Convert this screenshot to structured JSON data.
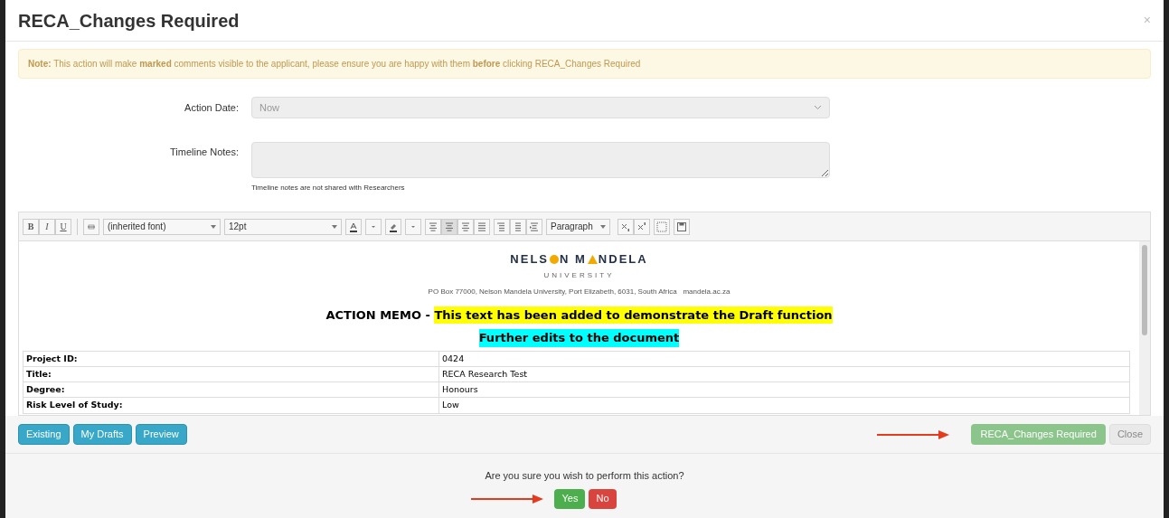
{
  "dialog": {
    "title": "RECA_Changes Required",
    "close": "×"
  },
  "note": "**Note:** This action will make **marked** comments visible to the applicant, please ensure you are happy with them **before** clicking RECA_Changes Required",
  "form": {
    "action_date": {
      "label": "Action Date:",
      "value": "Now",
      "disabled": true
    },
    "timeline_notes": {
      "label": "Timeline Notes:",
      "hint": "Timeline notes are not shared with Researchers",
      "disabled": true
    }
  },
  "toolbar": {
    "format_buttons": [
      "B",
      "I",
      "U"
    ],
    "font": "(inherited font)",
    "size": "12pt",
    "block": "Paragraph",
    "align_buttons": [
      {
        "selected": false
      },
      {
        "selected": true
      },
      {
        "selected": false
      },
      {
        "selected": false
      }
    ]
  },
  "document": {
    "logo_parts": [
      "NELS",
      "N M",
      "NDELA"
    ],
    "logo_subtitle": "UNIVERSITY",
    "address": "PO Box 77000, Nelson Mandela University, Port Elizabeth, 6031, South Africa   mandela.ac.za",
    "heading": "ACTION MEMO - ",
    "heading_highlight": {
      "text": "This text has been added to demonstrate the Draft function",
      "color": "#ffff00"
    },
    "subheading": {
      "text": "Further edits to the document",
      "color": "#00ffff"
    },
    "rows": [
      {
        "label": "Project ID:",
        "value": "0424"
      },
      {
        "label": "Title:",
        "value": "RECA Research Test"
      },
      {
        "label": "Degree:",
        "value": "Honours"
      },
      {
        "label": "Risk Level of Study:",
        "value": "Low"
      }
    ]
  },
  "left_buttons": [
    "Existing",
    "My Drafts",
    "Preview"
  ],
  "action_button": {
    "label": "RECA_Changes Required",
    "disabled": true
  },
  "close_button": "Close",
  "confirm": {
    "question": "Are you sure you wish to perform this action?",
    "yes": "Yes",
    "no": "No"
  }
}
